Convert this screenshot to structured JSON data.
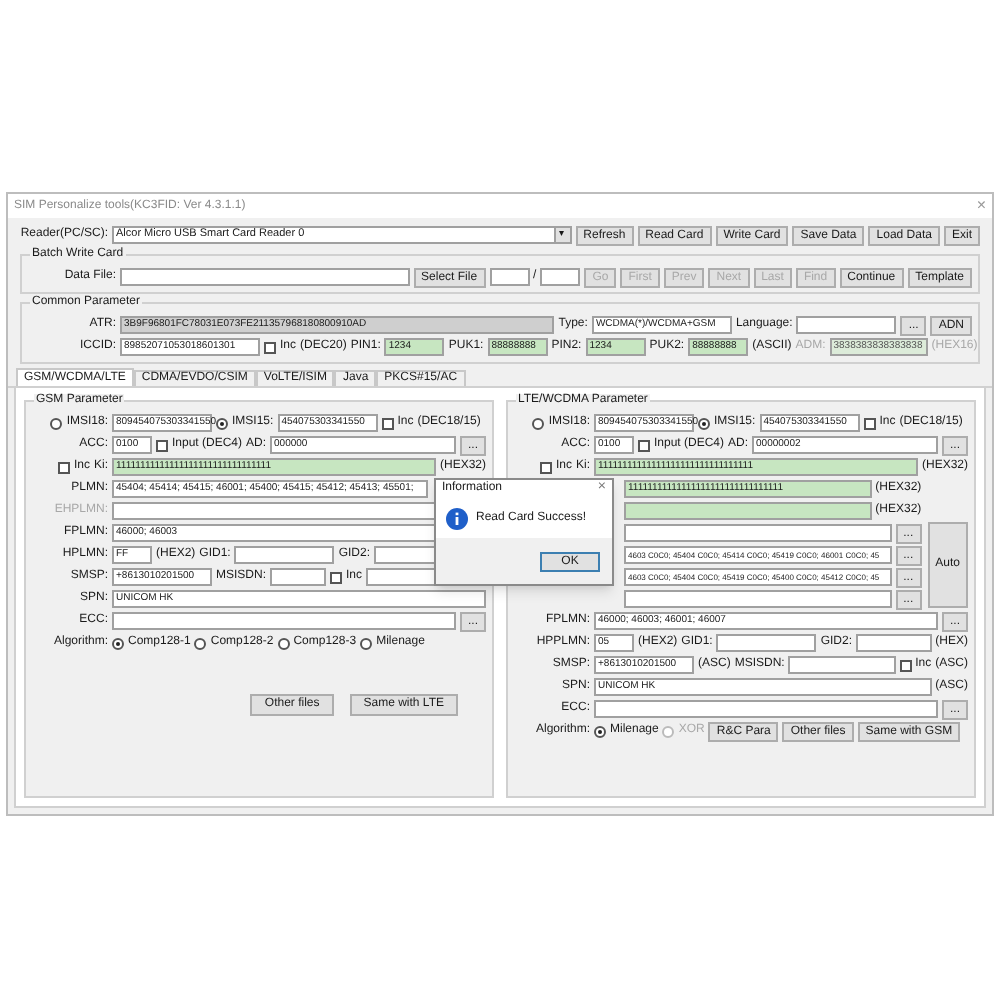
{
  "window": {
    "title": "SIM Personalize tools(KC3FID: Ver 4.3.1.1)",
    "close": "×"
  },
  "top_rows": [
    {
      "items": [
        {
          "kind": "head",
          "text": "Reader(PC/SC):"
        },
        {
          "kind": "select",
          "value": "Alcor Micro USB Smart Card Reader 0",
          "arrow": "▾"
        },
        {
          "kind": "button",
          "text": "Refresh"
        },
        {
          "kind": "button",
          "text": "Read Card"
        },
        {
          "kind": "button",
          "text": "Write Card"
        },
        {
          "kind": "button",
          "text": "Save Data"
        },
        {
          "kind": "button",
          "text": "Load Data"
        },
        {
          "kind": "button",
          "text": "Exit"
        }
      ]
    }
  ],
  "batch": {
    "title": "Batch Write Card",
    "rows": [
      {
        "items": [
          {
            "kind": "head",
            "text": "Data File:"
          },
          {
            "kind": "field"
          },
          {
            "kind": "button",
            "text": "Select File"
          },
          {
            "kind": "tiny"
          },
          {
            "kind": "label",
            "text": "/"
          },
          {
            "kind": "tiny"
          },
          {
            "kind": "button",
            "text": "Go",
            "disabled": true
          },
          {
            "kind": "button",
            "text": "First",
            "disabled": true
          },
          {
            "kind": "button",
            "text": "Prev",
            "disabled": true
          },
          {
            "kind": "button",
            "text": "Next",
            "disabled": true
          },
          {
            "kind": "button",
            "text": "Last",
            "disabled": true
          },
          {
            "kind": "button",
            "text": "Find",
            "disabled": true
          },
          {
            "kind": "button",
            "text": "Continue"
          },
          {
            "kind": "button",
            "text": "Template"
          }
        ]
      }
    ]
  },
  "common": {
    "title": "Common Parameter",
    "rows": [
      {
        "items": [
          {
            "kind": "head",
            "text": "ATR:"
          },
          {
            "kind": "readonly",
            "value": "3B9F96801FC78031E073FE211357968180800910AD"
          },
          {
            "kind": "label",
            "text": "Type:"
          },
          {
            "kind": "medium",
            "value": "WCDMA(*)/WCDMA+GSM"
          },
          {
            "kind": "label",
            "text": "Language:"
          },
          {
            "kind": "short"
          },
          {
            "kind": "button",
            "text": "..."
          },
          {
            "kind": "button",
            "text": "ADN"
          }
        ]
      },
      {
        "items": [
          {
            "kind": "head",
            "text": "ICCID:"
          },
          {
            "kind": "medium",
            "value": "89852071053018601301"
          },
          {
            "kind": "check",
            "text": "Inc",
            "checked": false
          },
          {
            "kind": "note",
            "text": "(DEC20)"
          },
          {
            "kind": "label",
            "text": "PIN1:"
          },
          {
            "kind": "pin",
            "value": "1234"
          },
          {
            "kind": "label",
            "text": "PUK1:"
          },
          {
            "kind": "pin",
            "value": "88888888"
          },
          {
            "kind": "label",
            "text": "PIN2:"
          },
          {
            "kind": "pin",
            "value": "1234"
          },
          {
            "kind": "label",
            "text": "PUK2:"
          },
          {
            "kind": "pin",
            "value": "88888888"
          },
          {
            "kind": "note",
            "text": "(ASCII)"
          },
          {
            "kind": "label",
            "text": "ADM:",
            "disabled": true
          },
          {
            "kind": "adm",
            "value": "3838383838383838",
            "disabled": true
          },
          {
            "kind": "note",
            "text": "(HEX16)",
            "disabled": true
          }
        ]
      }
    ]
  },
  "tabs": [
    {
      "label": "GSM/WCDMA/LTE",
      "selected": true
    },
    {
      "label": "CDMA/EVDO/CSIM",
      "selected": false
    },
    {
      "label": "VoLTE/ISIM",
      "selected": false
    },
    {
      "label": "Java",
      "selected": false
    },
    {
      "label": "PKCS#15/AC",
      "selected": false
    }
  ],
  "gsm": {
    "title": "GSM Parameter",
    "rows": [
      {
        "lead": [
          {
            "kind": "radio",
            "text": "IMSI18:",
            "selected": false
          }
        ],
        "items": [
          {
            "kind": "short",
            "value": "809454075303341550"
          },
          {
            "kind": "radio",
            "text": "IMSI15:",
            "selected": true
          },
          {
            "kind": "short",
            "value": "454075303341550"
          },
          {
            "kind": "check",
            "text": "Inc",
            "checked": false
          },
          {
            "kind": "note",
            "text": "(DEC18/15)"
          }
        ]
      },
      {
        "lead": [
          {
            "kind": "label",
            "text": "ACC:"
          }
        ],
        "items": [
          {
            "kind": "tiny",
            "value": "0100"
          },
          {
            "kind": "check",
            "text": "Input (DEC4)",
            "checked": false
          },
          {
            "kind": "label",
            "text": "AD:"
          },
          {
            "kind": "field",
            "value": "000000"
          },
          {
            "kind": "button",
            "text": "..."
          }
        ]
      },
      {
        "lead": [
          {
            "kind": "check",
            "text": "Inc",
            "checked": false
          },
          {
            "kind": "label",
            "text": "Ki:"
          }
        ],
        "items": [
          {
            "kind": "key",
            "value": "11111111111111111111111111111111"
          },
          {
            "kind": "note",
            "text": "(HEX32)"
          }
        ]
      },
      {
        "lead": [
          {
            "kind": "label",
            "text": "PLMN:"
          }
        ],
        "items": [
          {
            "kind": "plmn",
            "value": "45404; 45414; 45415; 46001; 45400; 45415; 45412; 45413; 45501;"
          }
        ]
      },
      {
        "lead": [
          {
            "kind": "label",
            "text": "EHPLMN:",
            "disabled": true
          }
        ],
        "items": [
          {
            "kind": "field"
          }
        ]
      },
      {
        "lead": [
          {
            "kind": "label",
            "text": "FPLMN:"
          }
        ],
        "items": [
          {
            "kind": "field",
            "value": "46000; 46003"
          }
        ]
      },
      {
        "lead": [
          {
            "kind": "label",
            "text": "HPLMN:"
          }
        ],
        "items": [
          {
            "kind": "tiny",
            "value": "FF"
          },
          {
            "kind": "note",
            "text": "(HEX2)"
          },
          {
            "kind": "label",
            "text": "GID1:"
          },
          {
            "kind": "short"
          },
          {
            "kind": "label",
            "text": "GID2:"
          },
          {
            "kind": "field"
          }
        ]
      },
      {
        "lead": [
          {
            "kind": "label",
            "text": "SMSP:"
          }
        ],
        "items": [
          {
            "kind": "short",
            "value": "+8613010201500"
          },
          {
            "kind": "label",
            "text": "MSISDN:"
          },
          {
            "kind": "small"
          },
          {
            "kind": "check",
            "text": "Inc",
            "checked": false
          },
          {
            "kind": "field"
          }
        ]
      },
      {
        "lead": [
          {
            "kind": "label",
            "text": "SPN:"
          }
        ],
        "items": [
          {
            "kind": "field",
            "value": "UNICOM HK"
          }
        ]
      },
      {
        "lead": [
          {
            "kind": "label",
            "text": "ECC:"
          }
        ],
        "items": [
          {
            "kind": "field"
          },
          {
            "kind": "button",
            "text": "..."
          }
        ]
      },
      {
        "lead": [
          {
            "kind": "label",
            "text": "Algorithm:"
          }
        ],
        "items": [
          {
            "kind": "radio",
            "text": "Comp128-1",
            "selected": true
          },
          {
            "kind": "radio",
            "text": "Comp128-2",
            "selected": false
          },
          {
            "kind": "radio",
            "text": "Comp128-3",
            "selected": false
          },
          {
            "kind": "radio",
            "text": "Milenage",
            "selected": false
          }
        ]
      }
    ],
    "buttons": [
      "Other files",
      "Same with LTE"
    ]
  },
  "lte": {
    "title": "LTE/WCDMA Parameter",
    "rows": [
      {
        "lead": [
          {
            "kind": "radio",
            "text": "IMSI18:",
            "selected": false
          }
        ],
        "items": [
          {
            "kind": "short",
            "value": "809454075303341550"
          },
          {
            "kind": "radio",
            "text": "IMSI15:",
            "selected": true
          },
          {
            "kind": "short",
            "value": "454075303341550"
          },
          {
            "kind": "check",
            "text": "Inc",
            "checked": false
          },
          {
            "kind": "note",
            "text": "(DEC18/15)"
          }
        ]
      },
      {
        "lead": [
          {
            "kind": "label",
            "text": "ACC:"
          }
        ],
        "items": [
          {
            "kind": "tiny",
            "value": "0100"
          },
          {
            "kind": "check",
            "text": "Input (DEC4)",
            "checked": false
          },
          {
            "kind": "label",
            "text": "AD:"
          },
          {
            "kind": "field",
            "value": "00000002"
          },
          {
            "kind": "button",
            "text": "..."
          }
        ]
      },
      {
        "lead": [
          {
            "kind": "check",
            "text": "Inc",
            "checked": false
          },
          {
            "kind": "label",
            "text": "Ki:"
          }
        ],
        "items": [
          {
            "kind": "key",
            "value": "11111111111111111111111111111111"
          },
          {
            "kind": "note",
            "text": "(HEX32)"
          }
        ]
      },
      {
        "group": [
          {
            "items": [
              {
                "kind": "key",
                "value": "11111111111111111111111111111111"
              },
              {
                "kind": "note",
                "text": "(HEX32)"
              }
            ]
          },
          {
            "items": [
              {
                "kind": "key"
              },
              {
                "kind": "note",
                "text": "(HEX32)"
              }
            ]
          },
          {
            "items": [
              {
                "kind": "field"
              },
              {
                "kind": "button",
                "text": "..."
              }
            ]
          },
          {
            "items": [
              {
                "kind": "list",
                "value": "4603 C0C0; 45404 C0C0; 45414 C0C0; 45419 C0C0; 46001 C0C0; 45"
              },
              {
                "kind": "button",
                "text": "..."
              }
            ]
          },
          {
            "items": [
              {
                "kind": "list",
                "value": "4603 C0C0; 45404 C0C0; 45419 C0C0; 45400 C0C0; 45412 C0C0; 45"
              },
              {
                "kind": "button",
                "text": "..."
              }
            ]
          },
          {
            "items": [
              {
                "kind": "field"
              },
              {
                "kind": "button",
                "text": "..."
              }
            ]
          }
        ],
        "side": "Auto"
      },
      {
        "lead": [
          {
            "kind": "label",
            "text": "FPLMN:"
          }
        ],
        "items": [
          {
            "kind": "field",
            "value": "46000; 46003; 46001; 46007"
          },
          {
            "kind": "button",
            "text": "..."
          }
        ]
      },
      {
        "lead": [
          {
            "kind": "label",
            "text": "HPPLMN:"
          }
        ],
        "items": [
          {
            "kind": "tiny",
            "value": "05"
          },
          {
            "kind": "note",
            "text": "(HEX2)"
          },
          {
            "kind": "label",
            "text": "GID1:"
          },
          {
            "kind": "short"
          },
          {
            "kind": "label",
            "text": "GID2:"
          },
          {
            "kind": "field"
          },
          {
            "kind": "note",
            "text": "(HEX)"
          }
        ]
      },
      {
        "lead": [
          {
            "kind": "label",
            "text": "SMSP:"
          }
        ],
        "items": [
          {
            "kind": "short",
            "value": "+8613010201500"
          },
          {
            "kind": "note",
            "text": "(ASC)"
          },
          {
            "kind": "label",
            "text": "MSISDN:"
          },
          {
            "kind": "field"
          },
          {
            "kind": "check",
            "text": "Inc",
            "checked": false
          },
          {
            "kind": "note",
            "text": "(ASC)"
          }
        ]
      },
      {
        "lead": [
          {
            "kind": "label",
            "text": "SPN:"
          }
        ],
        "items": [
          {
            "kind": "field",
            "value": "UNICOM HK"
          },
          {
            "kind": "note",
            "text": "(ASC)"
          }
        ]
      },
      {
        "lead": [
          {
            "kind": "label",
            "text": "ECC:"
          }
        ],
        "items": [
          {
            "kind": "field"
          },
          {
            "kind": "button",
            "text": "..."
          }
        ]
      },
      {
        "lead": [
          {
            "kind": "label",
            "text": "Algorithm:"
          }
        ],
        "items": [
          {
            "kind": "radio",
            "text": "Milenage",
            "selected": true
          },
          {
            "kind": "radio",
            "text": "XOR",
            "selected": false,
            "disabled": true
          },
          {
            "kind": "button",
            "text": "R&C Para"
          },
          {
            "kind": "button",
            "text": "Other files"
          },
          {
            "kind": "button",
            "text": "Same with GSM"
          }
        ]
      }
    ]
  },
  "dialog": {
    "title": "Information",
    "close": "×",
    "message": "Read Card Success!",
    "button": "OK"
  }
}
